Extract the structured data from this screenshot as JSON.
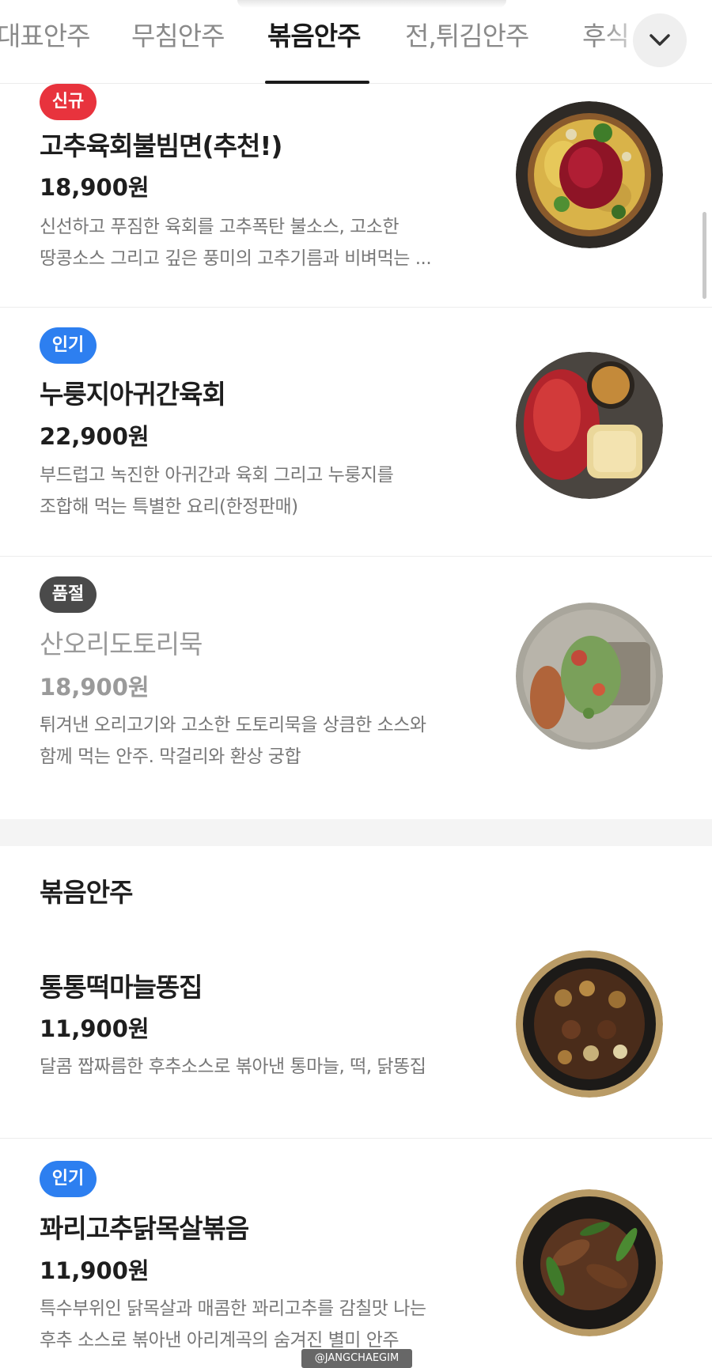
{
  "tabs": [
    {
      "label": "대표안주",
      "active": false
    },
    {
      "label": "무침안주",
      "active": false
    },
    {
      "label": "볶음안주",
      "active": true
    },
    {
      "label": "전,튀김안주",
      "active": false
    },
    {
      "label": "후식",
      "active": false
    }
  ],
  "expand_icon": "chevron-down-icon",
  "items_top": [
    {
      "badge": "신규",
      "name": "고추육회불빔면(추천!)",
      "price": "18,900원",
      "desc_line1": "신선하고 푸짐한 육회를 고추폭탄 불소스, 고소한",
      "desc_line2": "땅콩소스 그리고 깊은 풍미의 고추기름과 비벼먹는 ..."
    },
    {
      "badge": "인기",
      "name": "누룽지아귀간육회",
      "price": "22,900원",
      "desc_line1": "부드럽고 녹진한 아귀간과 육회 그리고 누룽지를",
      "desc_line2": "조합해 먹는 특별한 요리(한정판매)"
    },
    {
      "badge": "품절",
      "name": "산오리도토리묵",
      "price": "18,900원",
      "desc_line1": "튀겨낸 오리고기와 고소한 도토리묵을 상큼한 소스와",
      "desc_line2": "함께 먹는 안주. 막걸리와 환상 궁합"
    }
  ],
  "section": {
    "title": "볶음안주",
    "items": [
      {
        "name": "통통떡마늘똥집",
        "price": "11,900원",
        "desc_line1": "달콤 짭짜름한 후추소스로 볶아낸 통마늘, 떡, 닭똥집"
      },
      {
        "badge": "인기",
        "name": "꽈리고추닭목살볶음",
        "price": "11,900원",
        "desc_line1": "특수부위인 닭목살과 매콤한 꽈리고추를 감칠맛 나는",
        "desc_line2": "후추 소스로 볶아낸 아리계곡의 숨겨진 별미 안주"
      }
    ]
  },
  "watermark": "@JANGCHAEGIM",
  "colors": {
    "badge_new": "#e8333d",
    "badge_popular": "#2d7ff0",
    "badge_soldout": "#4a4a4a"
  }
}
